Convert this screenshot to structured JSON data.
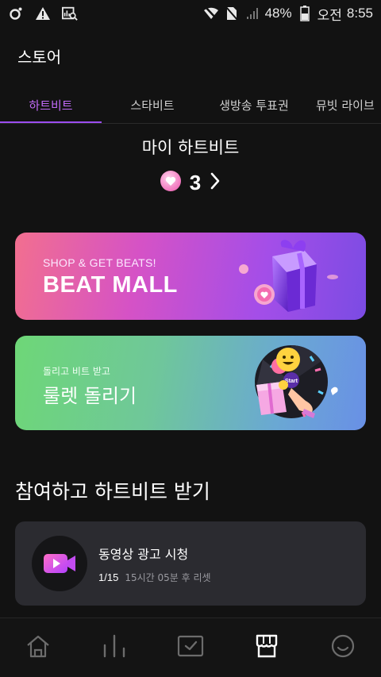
{
  "status_bar": {
    "battery": "48%",
    "ampm": "오전",
    "time": "8:55",
    "icons": [
      "app-o-icon",
      "warning-icon",
      "gallery-search-icon",
      "wifi-off-icon",
      "no-sim-icon",
      "signal-icon",
      "battery-icon"
    ]
  },
  "header": {
    "title": "스토어"
  },
  "tabs": [
    {
      "label": "하트비트",
      "active": true
    },
    {
      "label": "스타비트"
    },
    {
      "label": "생방송 투표권"
    },
    {
      "label": "뮤빗 라이브"
    }
  ],
  "my_beats": {
    "title": "마이 하트비트",
    "count": "3"
  },
  "banners": {
    "mall": {
      "subtitle": "SHOP & GET BEATS!",
      "title": "BEAT MALL"
    },
    "roulette": {
      "subtitle": "돌리고 비트 받고",
      "title": "룰렛 돌리기",
      "start_text": "Start"
    }
  },
  "section": {
    "title": "참여하고 하트비트 받기"
  },
  "task": {
    "title": "동영상 광고 시청",
    "progress": "1/15",
    "reset_text": "15시간 05분 후 리셋"
  },
  "bottom_nav": [
    "home-icon",
    "chart-icon",
    "vote-check-icon",
    "store-icon",
    "profile-smile-icon"
  ],
  "colors": {
    "accent": "#c06af7",
    "background": "#121212",
    "card": "#2b2b30"
  }
}
